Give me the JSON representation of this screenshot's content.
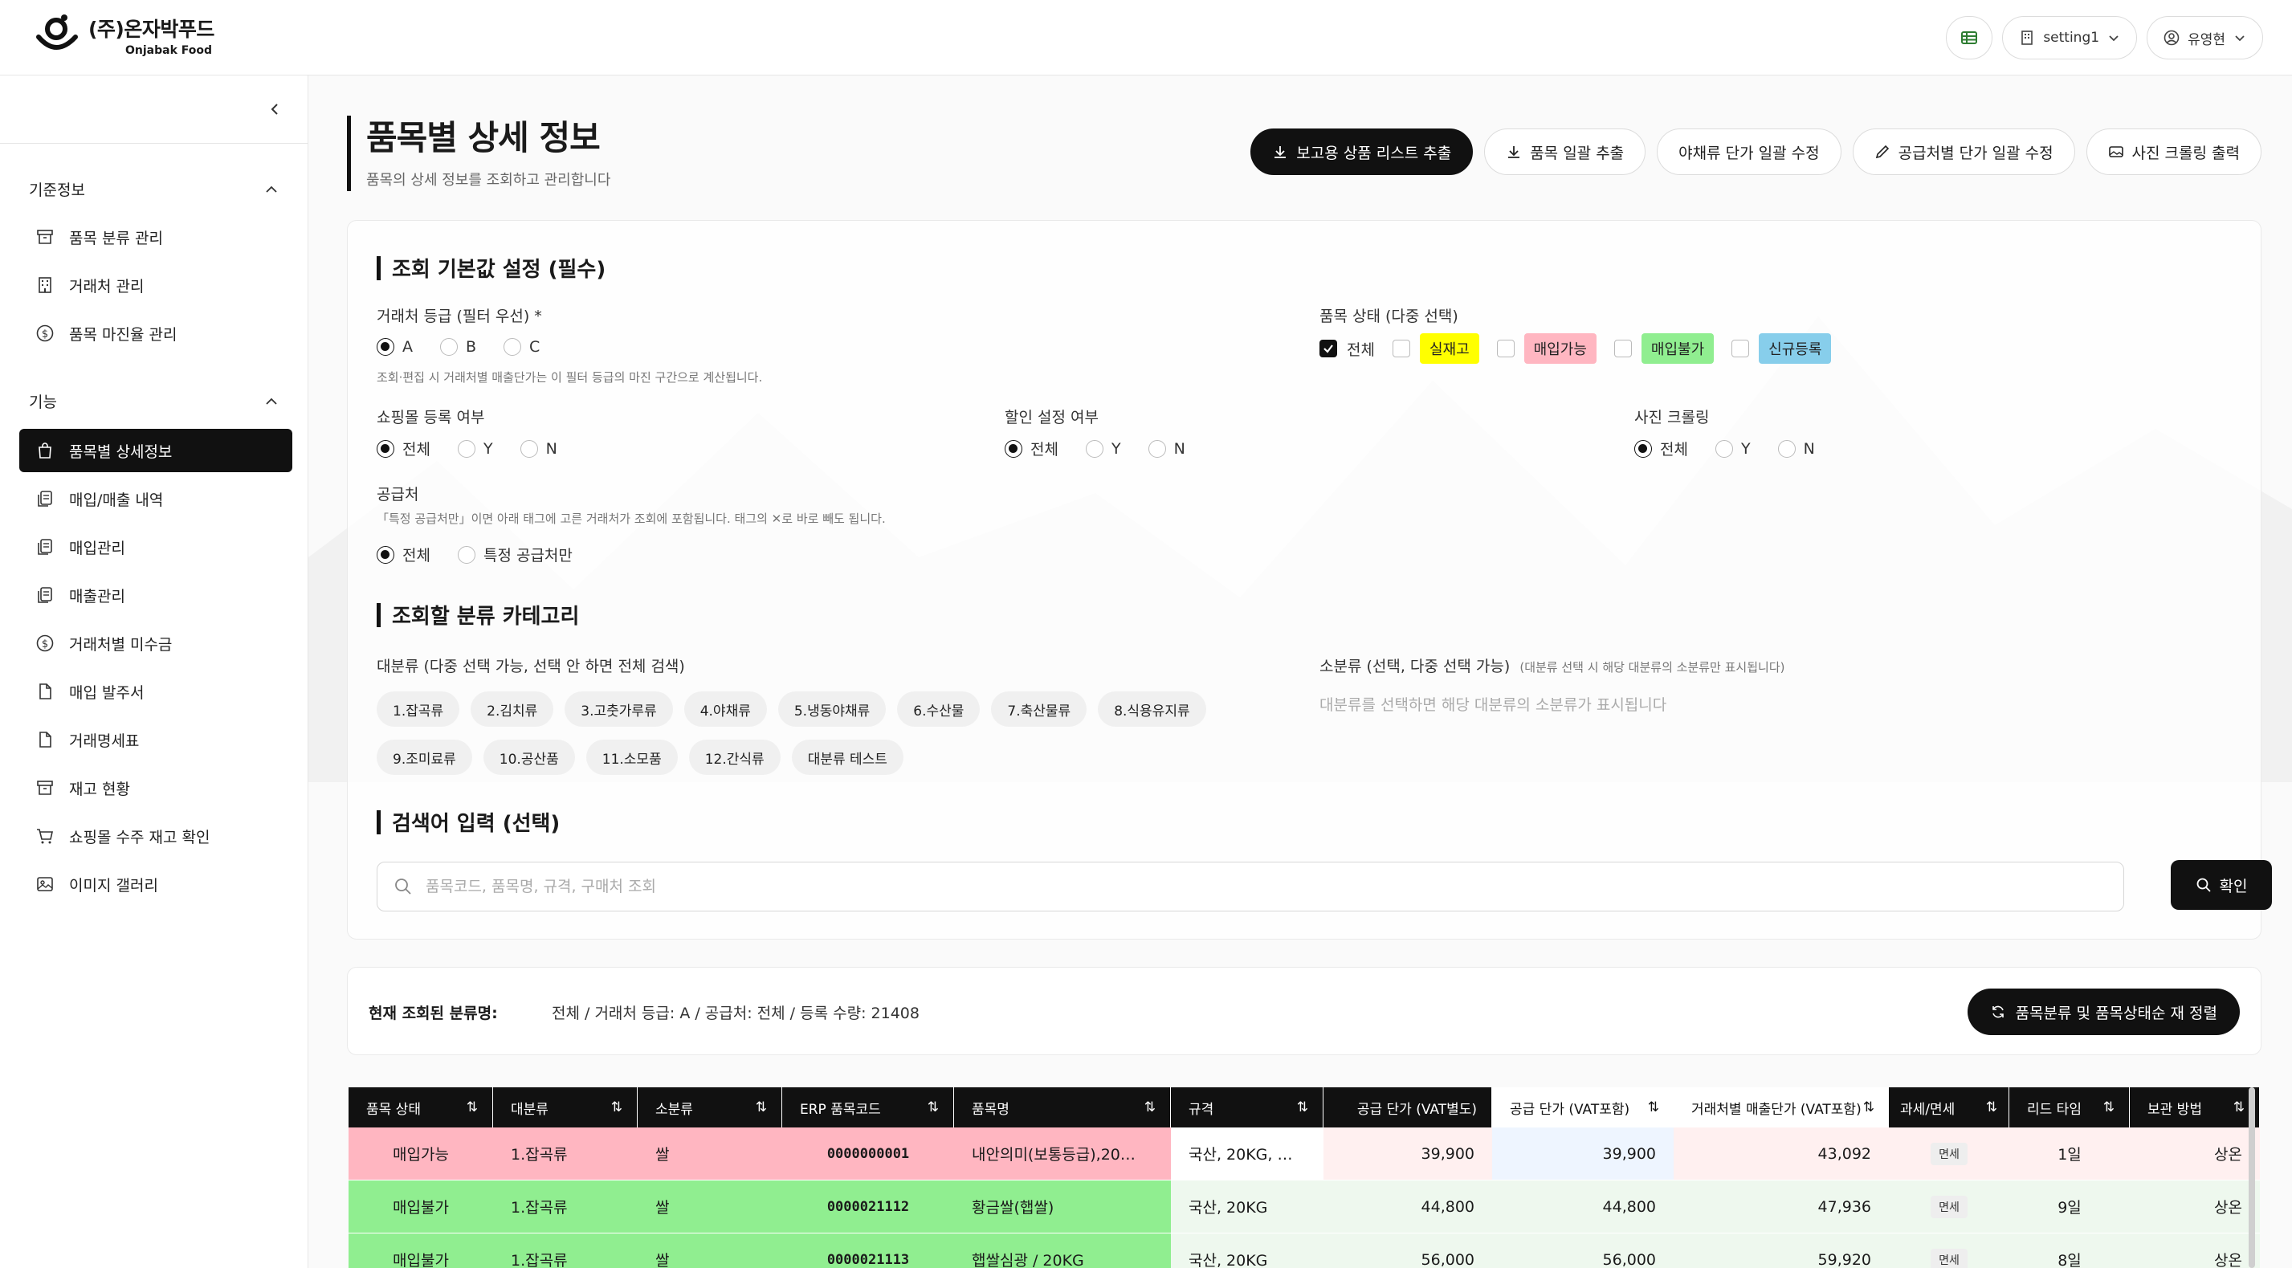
{
  "header": {
    "company_ko": "(주)온자박푸드",
    "company_en": "Onjabak Food",
    "setting_label": "setting1",
    "user_name": "유영현"
  },
  "sidebar": {
    "groups": [
      {
        "title": "기준정보",
        "items": [
          {
            "label": "품목 분류 관리",
            "icon": "archive-icon"
          },
          {
            "label": "거래처 관리",
            "icon": "building-icon"
          },
          {
            "label": "품목 마진율 관리",
            "icon": "dollar-circle-icon"
          }
        ]
      },
      {
        "title": "기능",
        "items": [
          {
            "label": "품목별 상세정보",
            "icon": "bag-icon",
            "active": true
          },
          {
            "label": "매입/매출 내역",
            "icon": "docs-icon"
          },
          {
            "label": "매입관리",
            "icon": "docs-icon"
          },
          {
            "label": "매출관리",
            "icon": "docs-icon"
          },
          {
            "label": "거래처별 미수금",
            "icon": "dollar-circle-icon"
          },
          {
            "label": "매입 발주서",
            "icon": "file-icon"
          },
          {
            "label": "거래명세표",
            "icon": "file-icon"
          },
          {
            "label": "재고 현황",
            "icon": "archive-icon"
          },
          {
            "label": "쇼핑몰 수주 재고 확인",
            "icon": "cart-icon"
          },
          {
            "label": "이미지 갤러리",
            "icon": "image-icon"
          }
        ]
      }
    ]
  },
  "page": {
    "title": "품목별 상세 정보",
    "subtitle": "품목의 상세 정보를 조회하고 관리합니다"
  },
  "actions": [
    {
      "label": "보고용 상품 리스트 추출",
      "icon": "download-icon",
      "primary": true
    },
    {
      "label": "품목 일괄 추출",
      "icon": "download-icon"
    },
    {
      "label": "야채류 단가 일괄 수정",
      "icon": ""
    },
    {
      "label": "공급처별 단가 일괄 수정",
      "icon": "pencil-icon"
    },
    {
      "label": "사진 크롤링 출력",
      "icon": "image-icon"
    }
  ],
  "filters": {
    "section_title": "조회 기본값 설정 (필수)",
    "grade": {
      "label": "거래처 등급 (필터 우선) *",
      "options": [
        "A",
        "B",
        "C"
      ],
      "selected": "A",
      "hint": "조회·편집 시 거래처별 매출단가는 이 필터 등급의 마진 구간으로 계산됩니다."
    },
    "status": {
      "label": "품목 상태 (다중 선택)",
      "all_label": "전체",
      "tags": [
        {
          "label": "실재고",
          "color": "#ffff00"
        },
        {
          "label": "매입가능",
          "color": "#ffb6c1"
        },
        {
          "label": "매입불가",
          "color": "#90ee90"
        },
        {
          "label": "신규등록",
          "color": "#87ceeb"
        }
      ]
    },
    "mall": {
      "label": "쇼핑몰 등록 여부",
      "options": [
        "전체",
        "Y",
        "N"
      ],
      "selected": "전체"
    },
    "discount": {
      "label": "할인 설정 여부",
      "options": [
        "전체",
        "Y",
        "N"
      ],
      "selected": "전체"
    },
    "crawl": {
      "label": "사진 크롤링",
      "options": [
        "전체",
        "Y",
        "N"
      ],
      "selected": "전체"
    },
    "supplier": {
      "label": "공급처",
      "hint": "「특정 공급처만」이면 아래 태그에 고른 거래처가 조회에 포함됩니다. 태그의 ✕로 바로 빼도 됩니다.",
      "options": [
        "전체",
        "특정 공급처만"
      ],
      "selected": "전체"
    }
  },
  "category": {
    "section_title": "조회할 분류 카테고리",
    "major_label": "대분류 (다중 선택 가능, 선택 안 하면 전체 검색)",
    "minor_label": "소분류 (선택, 다중 선택 가능)",
    "minor_note": "(대분류 선택 시 해당 대분류의 소분류만 표시됩니다)",
    "minor_placeholder": "대분류를 선택하면 해당 대분류의 소분류가 표시됩니다",
    "majors": [
      "1.잡곡류",
      "2.김치류",
      "3.고춧가루류",
      "4.야채류",
      "5.냉동야채류",
      "6.수산물",
      "7.축산물류",
      "8.식용유지류",
      "9.조미료류",
      "10.공산품",
      "11.소모품",
      "12.간식류",
      "대분류 테스트"
    ]
  },
  "search": {
    "section_title": "검색어 입력 (선택)",
    "placeholder": "품목코드, 품목명, 규격, 구매처 조회",
    "confirm_label": "확인"
  },
  "summary": {
    "label": "현재 조회된 분류명:",
    "text": "전체 / 거래처 등급: A / 공급처: 전체 / 등록 수량: 21408",
    "sort_label": "품목분류 및 품목상태순 재 정렬"
  },
  "table": {
    "columns": [
      "품목 상태",
      "대분류",
      "소분류",
      "ERP 품목코드",
      "품목명",
      "규격",
      "공급 단가 (VAT별도)",
      "공급 단가 (VAT포함)",
      "거래처별 매출단가 (VAT포함)",
      "과세/면세",
      "리드 타임",
      "보관 방법"
    ],
    "rows": [
      {
        "status": "매입가능",
        "color": "#ffb6c1",
        "major": "1.잡곡류",
        "minor": "쌀",
        "code": "0000000001",
        "name": "내안의미(보통등급),20…",
        "spec": "국산, 20KG, …",
        "supply": "39,900",
        "supply_vat": "39,900",
        "sale": "43,092",
        "tax": "면세",
        "lead": "1일",
        "storage": "상온"
      },
      {
        "status": "매입불가",
        "color": "#90ee90",
        "major": "1.잡곡류",
        "minor": "쌀",
        "code": "0000021112",
        "name": "황금쌀(햅쌀)",
        "spec": "국산, 20KG",
        "supply": "44,800",
        "supply_vat": "44,800",
        "sale": "47,936",
        "tax": "면세",
        "lead": "9일",
        "storage": "상온"
      },
      {
        "status": "매입불가",
        "color": "#90ee90",
        "major": "1.잡곡류",
        "minor": "쌀",
        "code": "0000021113",
        "name": "햅쌀심광 / 20KG",
        "spec": "국산, 20KG",
        "supply": "56,000",
        "supply_vat": "56,000",
        "sale": "59,920",
        "tax": "면세",
        "lead": "8일",
        "storage": "상온"
      }
    ]
  },
  "colors": {
    "accent": "#111111",
    "supply_bg": "#fff0f0",
    "supply_vat_bg": "#eef5ff"
  }
}
